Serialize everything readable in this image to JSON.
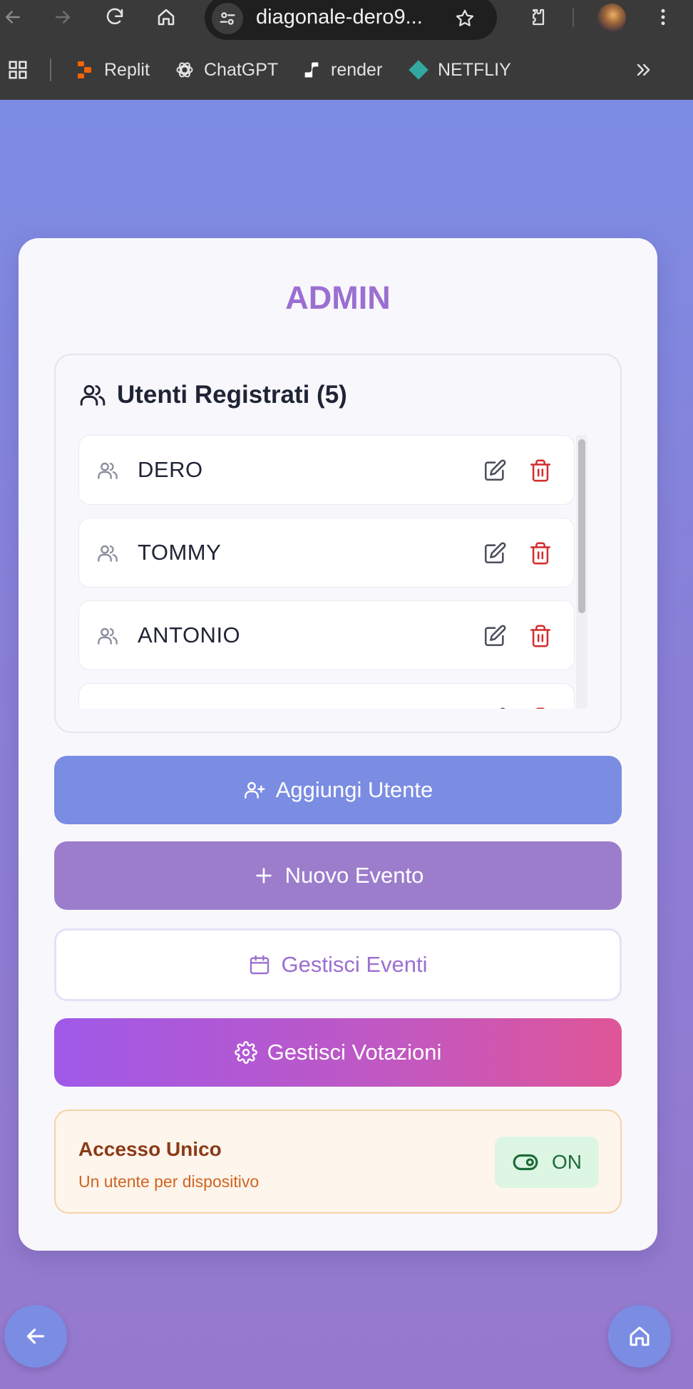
{
  "browser": {
    "url": "diagonale-dero9...",
    "bookmarks": [
      {
        "label": "Replit",
        "icon": "replit-icon"
      },
      {
        "label": "ChatGPT",
        "icon": "chatgpt-icon"
      },
      {
        "label": "render",
        "icon": "render-icon"
      },
      {
        "label": "NETFLIY",
        "icon": "netlify-icon"
      }
    ]
  },
  "admin": {
    "title": "ADMIN",
    "users_title": "Utenti Registrati (5)",
    "users": [
      {
        "name": "DERO"
      },
      {
        "name": "TOMMY"
      },
      {
        "name": "ANTONIO"
      },
      {
        "name": ""
      }
    ],
    "buttons": {
      "add_user": "Aggiungi Utente",
      "new_event": "Nuovo Evento",
      "manage_events": "Gestisci Eventi",
      "manage_votes": "Gestisci Votazioni"
    },
    "access": {
      "title": "Accesso Unico",
      "subtitle": "Un utente per dispositivo",
      "toggle_label": "ON"
    }
  },
  "colors": {
    "accent_purple": "#9b6fd1",
    "button_blue": "#7b8ce3",
    "delete_red": "#d32f2f",
    "toggle_green": "#1e6b3a"
  }
}
